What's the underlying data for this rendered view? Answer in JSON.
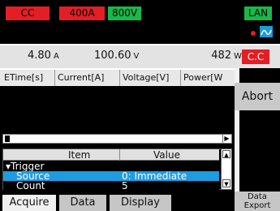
{
  "status": {
    "mode": "CC",
    "current_range": "400A",
    "voltage_range": "800V",
    "interface": "LAN",
    "indicator_dot_color": "#e31e24",
    "wave_icon_color": "#1d9bd6"
  },
  "measurements": {
    "current": "4.80",
    "current_unit": "A",
    "voltage": "100.60",
    "voltage_unit": "V",
    "power": "482",
    "power_unit": "W",
    "mode_badge": "C.C"
  },
  "data_table": {
    "columns": [
      "ETime[s]",
      "Current[A]",
      "Voltage[V]",
      "Power[W"
    ]
  },
  "abort_label": "Abort",
  "settings": {
    "header_item": "Item",
    "header_value": "Value",
    "group": "Trigger",
    "rows": [
      {
        "item": "Source",
        "value": "0: Immediate",
        "selected": true
      },
      {
        "item": "Count",
        "value": "5",
        "selected": false
      }
    ]
  },
  "tabs": {
    "acquire": "Acquire",
    "data": "Data",
    "display": "Display",
    "data_export": "Data Export"
  },
  "colors": {
    "red": "#e31e24",
    "green": "#19b84a",
    "selection_blue": "#1e9ce0"
  }
}
